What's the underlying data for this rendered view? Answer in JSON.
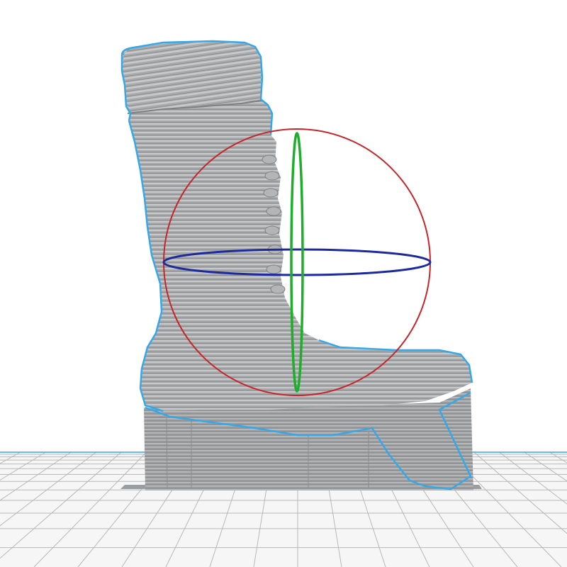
{
  "viewport": {
    "background": "#ffffff",
    "grid_color": "#b8b8b8",
    "grid_face_color": "#f6f6f6",
    "model_color": "#a7a9ab",
    "model_stripe_color": "#8a8c8e",
    "model_highlight_color": "#c4c6c8",
    "outline_color": "#35a8e8",
    "support_color": "#9a9c9e"
  },
  "gizmo": {
    "x_ring_color": "#c4262b",
    "y_ring_color": "#1fae2b",
    "z_ring_color": "#1c2a9c",
    "center_icon": "rotate-gizmo-icon"
  }
}
